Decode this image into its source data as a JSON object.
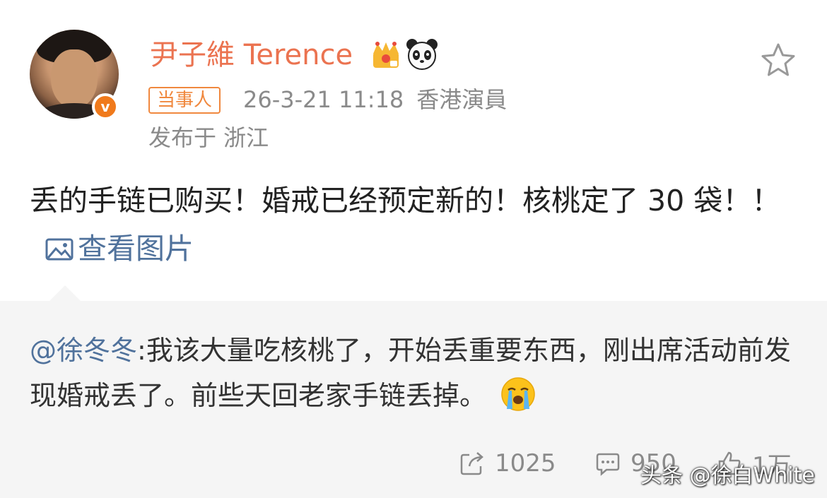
{
  "user": {
    "name": "尹子維 Terence",
    "verified_badge": "v",
    "tag": "当事人",
    "timestamp": "26-3-21 11:18",
    "source": "香港演員",
    "location": "发布于 浙江"
  },
  "post": {
    "text": "丢的手链已购买！婚戒已经预定新的！核桃定了 30 袋！！",
    "view_pics_label": "查看图片"
  },
  "repost": {
    "mention": "@徐冬冬",
    "text": ":我该大量吃核桃了，开始丢重要东西，刚出席活动前发现婚戒丢了。前些天回老家手链丢掉。"
  },
  "actions": {
    "repost_count": "1025",
    "comment_count": "950",
    "like_count": "1万"
  },
  "watermark": "头条 @徐白White",
  "colors": {
    "username": "#eb7350",
    "tag": "#f0883e",
    "link": "#50729c",
    "meta": "#8a8a8a",
    "repost_bg": "#f5f5f5"
  },
  "icons": [
    "verified-badge-icon",
    "crown-icon",
    "panda-icon",
    "star-icon",
    "picture-icon",
    "crying-emoji-icon",
    "repost-icon",
    "comment-icon",
    "like-icon"
  ]
}
